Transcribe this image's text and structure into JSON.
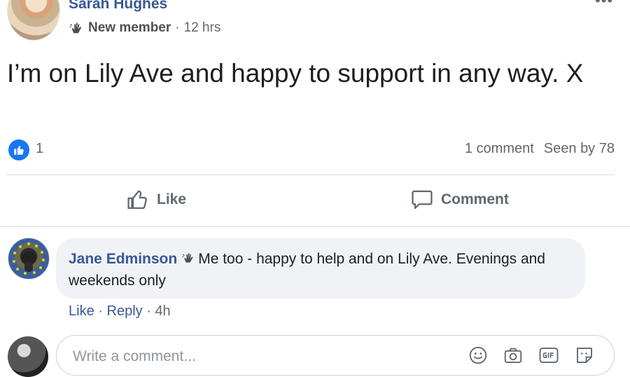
{
  "post": {
    "author": "Sarah Hughes",
    "badge": "New member",
    "separator": "·",
    "time": "12 hrs",
    "text": "I’m on Lily Ave and happy to support in any way. X",
    "more": "•••"
  },
  "stats": {
    "like_count": "1",
    "comments": "1 comment",
    "seen": "Seen by 78"
  },
  "actions": {
    "like": "Like",
    "comment": "Comment"
  },
  "comment": {
    "author": "Jane Edminson",
    "text": "Me too - happy to help and on Lily Ave. Evenings and weekends only",
    "like": "Like",
    "separator": "·",
    "reply": "Reply",
    "time": "4h"
  },
  "composer": {
    "placeholder": "Write a comment..."
  },
  "colors": {
    "link": "#385898",
    "like_blue": "#1877f2",
    "muted": "#606770",
    "bubble": "#f0f2f5"
  }
}
